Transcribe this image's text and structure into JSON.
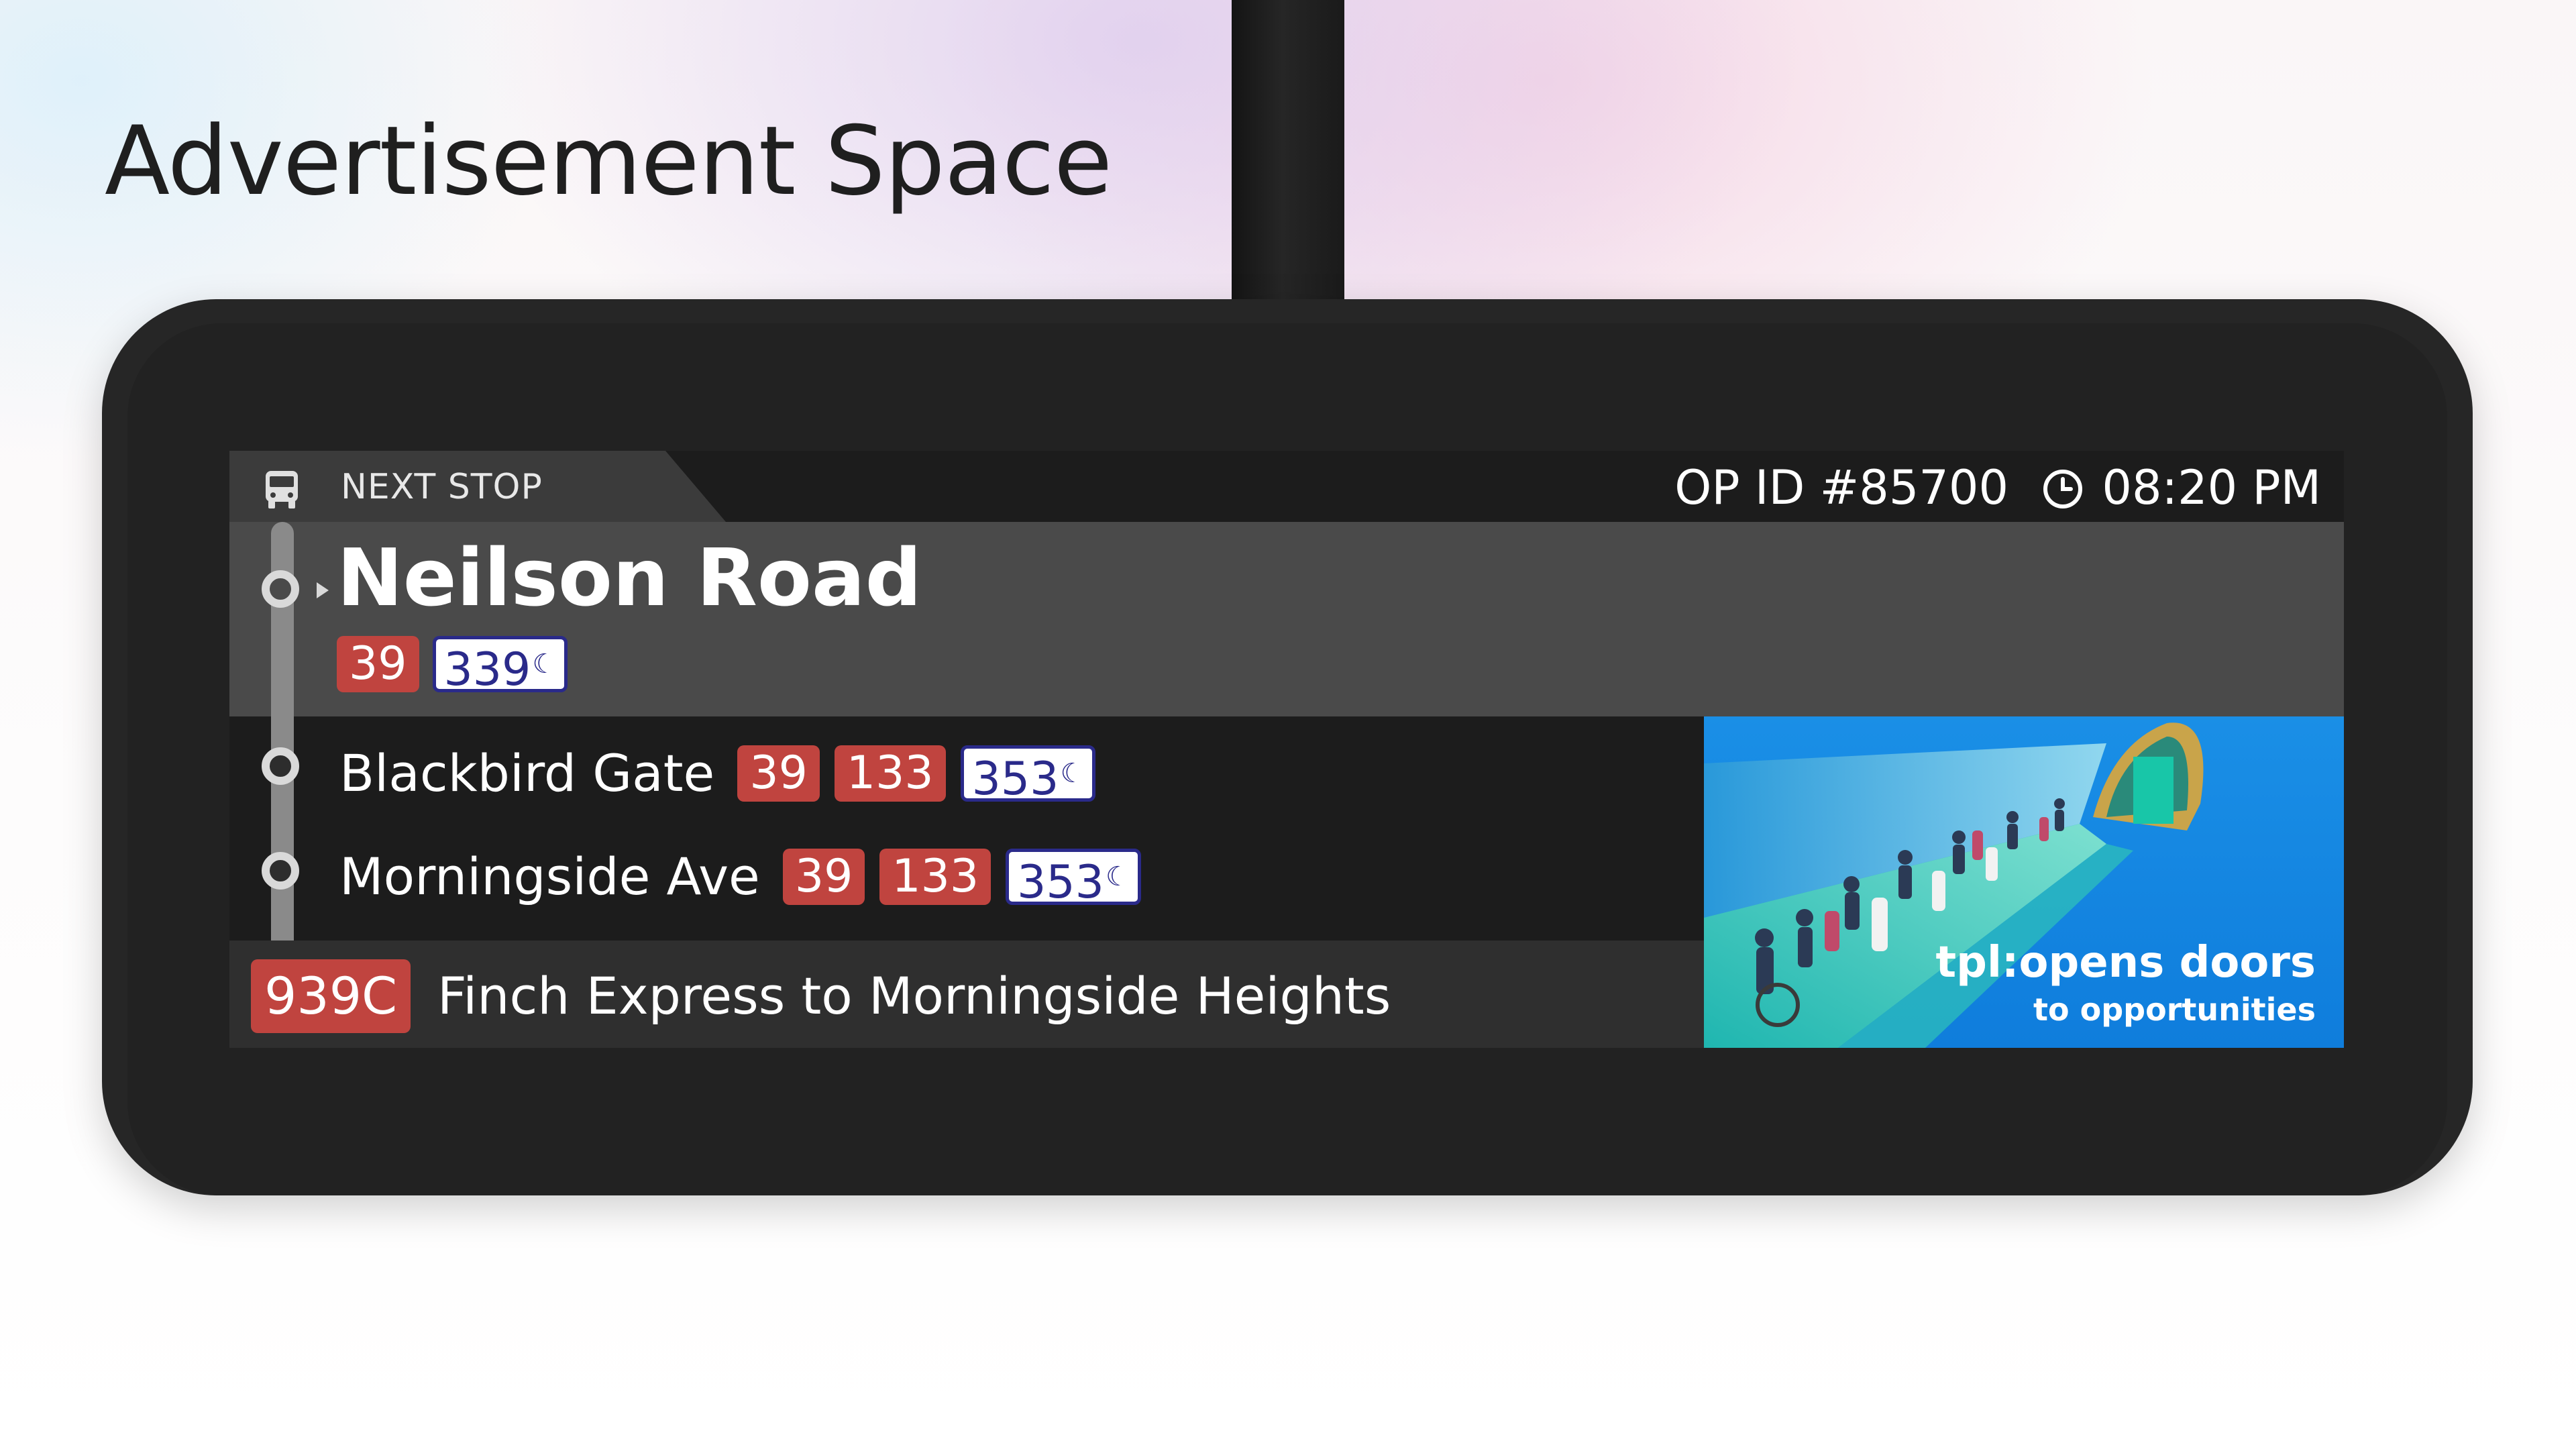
{
  "page": {
    "title": "Advertisement Space"
  },
  "header": {
    "next_stop_label": "NEXT STOP",
    "op_id": "OP ID #85700",
    "time": "08:20 PM",
    "bus_icon": "bus-icon",
    "clock_icon": "clock-icon"
  },
  "current_stop": {
    "name": "Neilson Road",
    "routes": [
      {
        "label": "39",
        "type": "day"
      },
      {
        "label": "339",
        "type": "night"
      }
    ]
  },
  "upcoming_stops": [
    {
      "name": "Blackbird Gate",
      "routes": [
        {
          "label": "39",
          "type": "day"
        },
        {
          "label": "133",
          "type": "day"
        },
        {
          "label": "353",
          "type": "night"
        }
      ]
    },
    {
      "name": "Morningside Ave",
      "routes": [
        {
          "label": "39",
          "type": "day"
        },
        {
          "label": "133",
          "type": "day"
        },
        {
          "label": "353",
          "type": "night"
        }
      ]
    }
  ],
  "express": {
    "route": "939C",
    "description": "Finch Express to Morningside Heights"
  },
  "ad": {
    "brand": "tpl:opens doors",
    "tagline": "to opportunities"
  },
  "colors": {
    "day_route": "#c0443f",
    "night_route_text": "#2a2a8a",
    "ad_background": "#1a8fe6"
  }
}
